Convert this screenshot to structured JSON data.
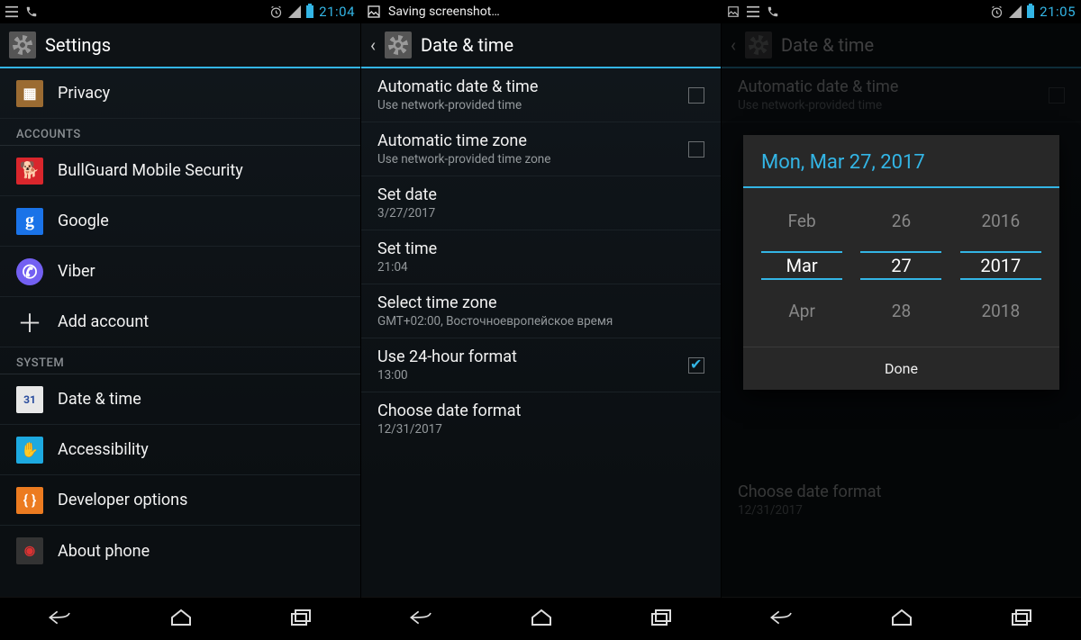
{
  "panel1": {
    "status_time": "21:04",
    "title": "Settings",
    "items": {
      "privacy": "Privacy",
      "accounts_header": "ACCOUNTS",
      "bullguard": "BullGuard Mobile Security",
      "google": "Google",
      "viber": "Viber",
      "add_account": "Add account",
      "system_header": "SYSTEM",
      "datetime": "Date & time",
      "accessibility": "Accessibility",
      "developer": "Developer options",
      "about": "About phone"
    }
  },
  "panel2": {
    "toast": "Saving screenshot…",
    "title": "Date & time",
    "rows": {
      "auto_dt_t": "Automatic date & time",
      "auto_dt_s": "Use network-provided time",
      "auto_tz_t": "Automatic time zone",
      "auto_tz_s": "Use network-provided time zone",
      "set_date_t": "Set date",
      "set_date_s": "3/27/2017",
      "set_time_t": "Set time",
      "set_time_s": "21:04",
      "tz_t": "Select time zone",
      "tz_s": "GMT+02:00, Восточноевропейское время",
      "h24_t": "Use 24-hour format",
      "h24_s": "13:00",
      "fmt_t": "Choose date format",
      "fmt_s": "12/31/2017"
    }
  },
  "panel3": {
    "status_time": "21:05",
    "title": "Date & time",
    "bg_auto_t": "Automatic date & time",
    "bg_auto_s": "Use network-provided time",
    "bg_fmt_t": "Choose date format",
    "bg_fmt_s": "12/31/2017",
    "dialog_header": "Mon, Mar 27, 2017",
    "picker": {
      "month": {
        "prev": "Feb",
        "sel": "Mar",
        "next": "Apr"
      },
      "day": {
        "prev": "26",
        "sel": "27",
        "next": "28"
      },
      "year": {
        "prev": "2016",
        "sel": "2017",
        "next": "2018"
      }
    },
    "done": "Done"
  }
}
